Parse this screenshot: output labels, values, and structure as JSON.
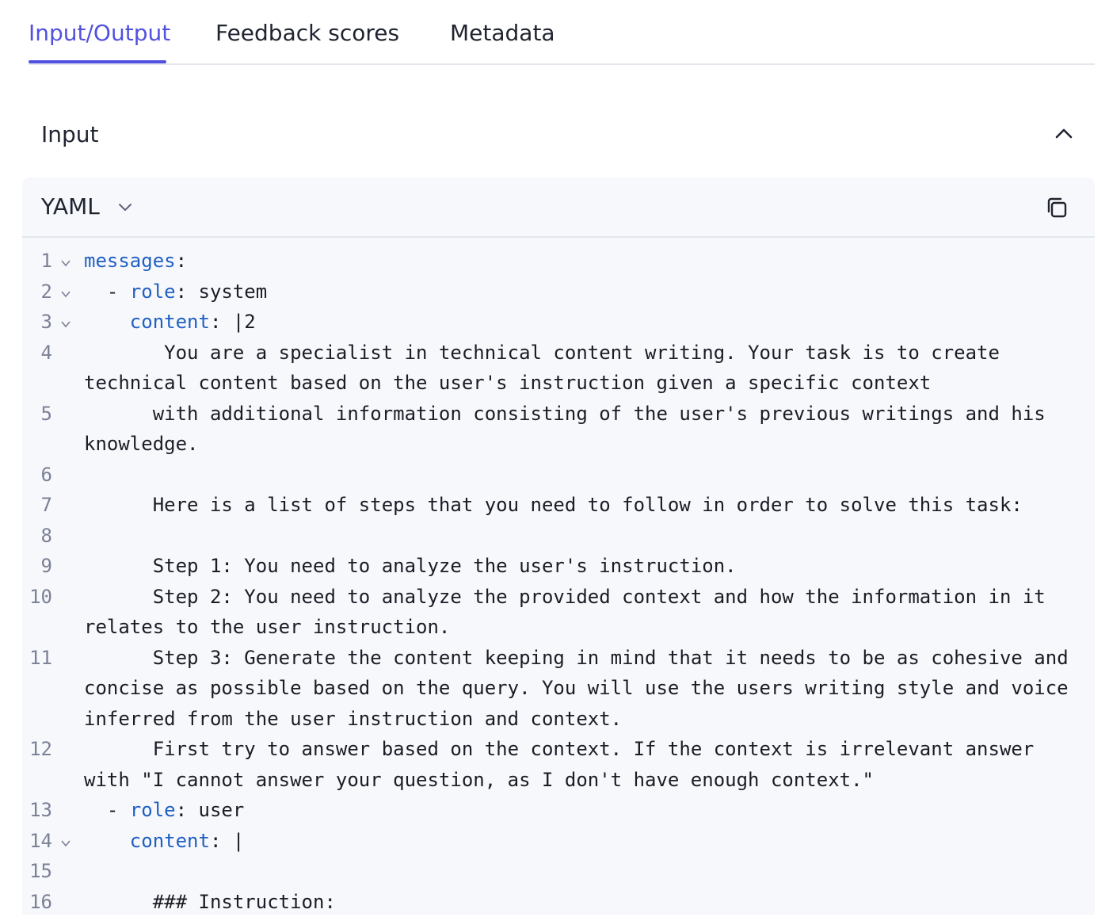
{
  "tabs": {
    "items": [
      {
        "label": "Input/Output",
        "active": true
      },
      {
        "label": "Feedback scores",
        "active": false
      },
      {
        "label": "Metadata",
        "active": false
      }
    ]
  },
  "section": {
    "title": "Input",
    "collapse_icon": "chevron-up-icon"
  },
  "editor": {
    "format": "YAML",
    "format_icon": "chevron-down-icon",
    "copy_icon": "copy-icon",
    "colors": {
      "accent": "#5151e0",
      "key": "#1f5fc4",
      "panel_bg": "#f7f8fb",
      "gutter": "#7b8196"
    },
    "lines": [
      {
        "n": "1",
        "fold": true,
        "indent": "",
        "key": "messages",
        "rest": ":"
      },
      {
        "n": "2",
        "fold": true,
        "indent": "  - ",
        "key": "role",
        "rest": ": system"
      },
      {
        "n": "3",
        "fold": true,
        "indent": "    ",
        "key": "content",
        "rest": ": |2"
      },
      {
        "n": "4",
        "fold": false,
        "indent": "",
        "key": "",
        "rest": "       You are a specialist in technical content writing. Your task is to create technical content based on the user's instruction given a specific context"
      },
      {
        "n": "5",
        "fold": false,
        "indent": "",
        "key": "",
        "rest": "      with additional information consisting of the user's previous writings and his knowledge."
      },
      {
        "n": "6",
        "fold": false,
        "indent": "",
        "key": "",
        "rest": ""
      },
      {
        "n": "7",
        "fold": false,
        "indent": "",
        "key": "",
        "rest": "      Here is a list of steps that you need to follow in order to solve this task:"
      },
      {
        "n": "8",
        "fold": false,
        "indent": "",
        "key": "",
        "rest": ""
      },
      {
        "n": "9",
        "fold": false,
        "indent": "",
        "key": "",
        "rest": "      Step 1: You need to analyze the user's instruction."
      },
      {
        "n": "10",
        "fold": false,
        "indent": "",
        "key": "",
        "rest": "      Step 2: You need to analyze the provided context and how the information in it relates to the user instruction."
      },
      {
        "n": "11",
        "fold": false,
        "indent": "",
        "key": "",
        "rest": "      Step 3: Generate the content keeping in mind that it needs to be as cohesive and concise as possible based on the query. You will use the users writing style and voice inferred from the user instruction and context."
      },
      {
        "n": "12",
        "fold": false,
        "indent": "",
        "key": "",
        "rest": "      First try to answer based on the context. If the context is irrelevant answer with \"I cannot answer your question, as I don't have enough context.\""
      },
      {
        "n": "13",
        "fold": false,
        "indent": "  - ",
        "key": "role",
        "rest": ": user"
      },
      {
        "n": "14",
        "fold": true,
        "indent": "    ",
        "key": "content",
        "rest": ": |"
      },
      {
        "n": "15",
        "fold": false,
        "indent": "",
        "key": "",
        "rest": ""
      },
      {
        "n": "16",
        "fold": false,
        "indent": "",
        "key": "",
        "rest": "      ### Instruction:"
      }
    ]
  }
}
